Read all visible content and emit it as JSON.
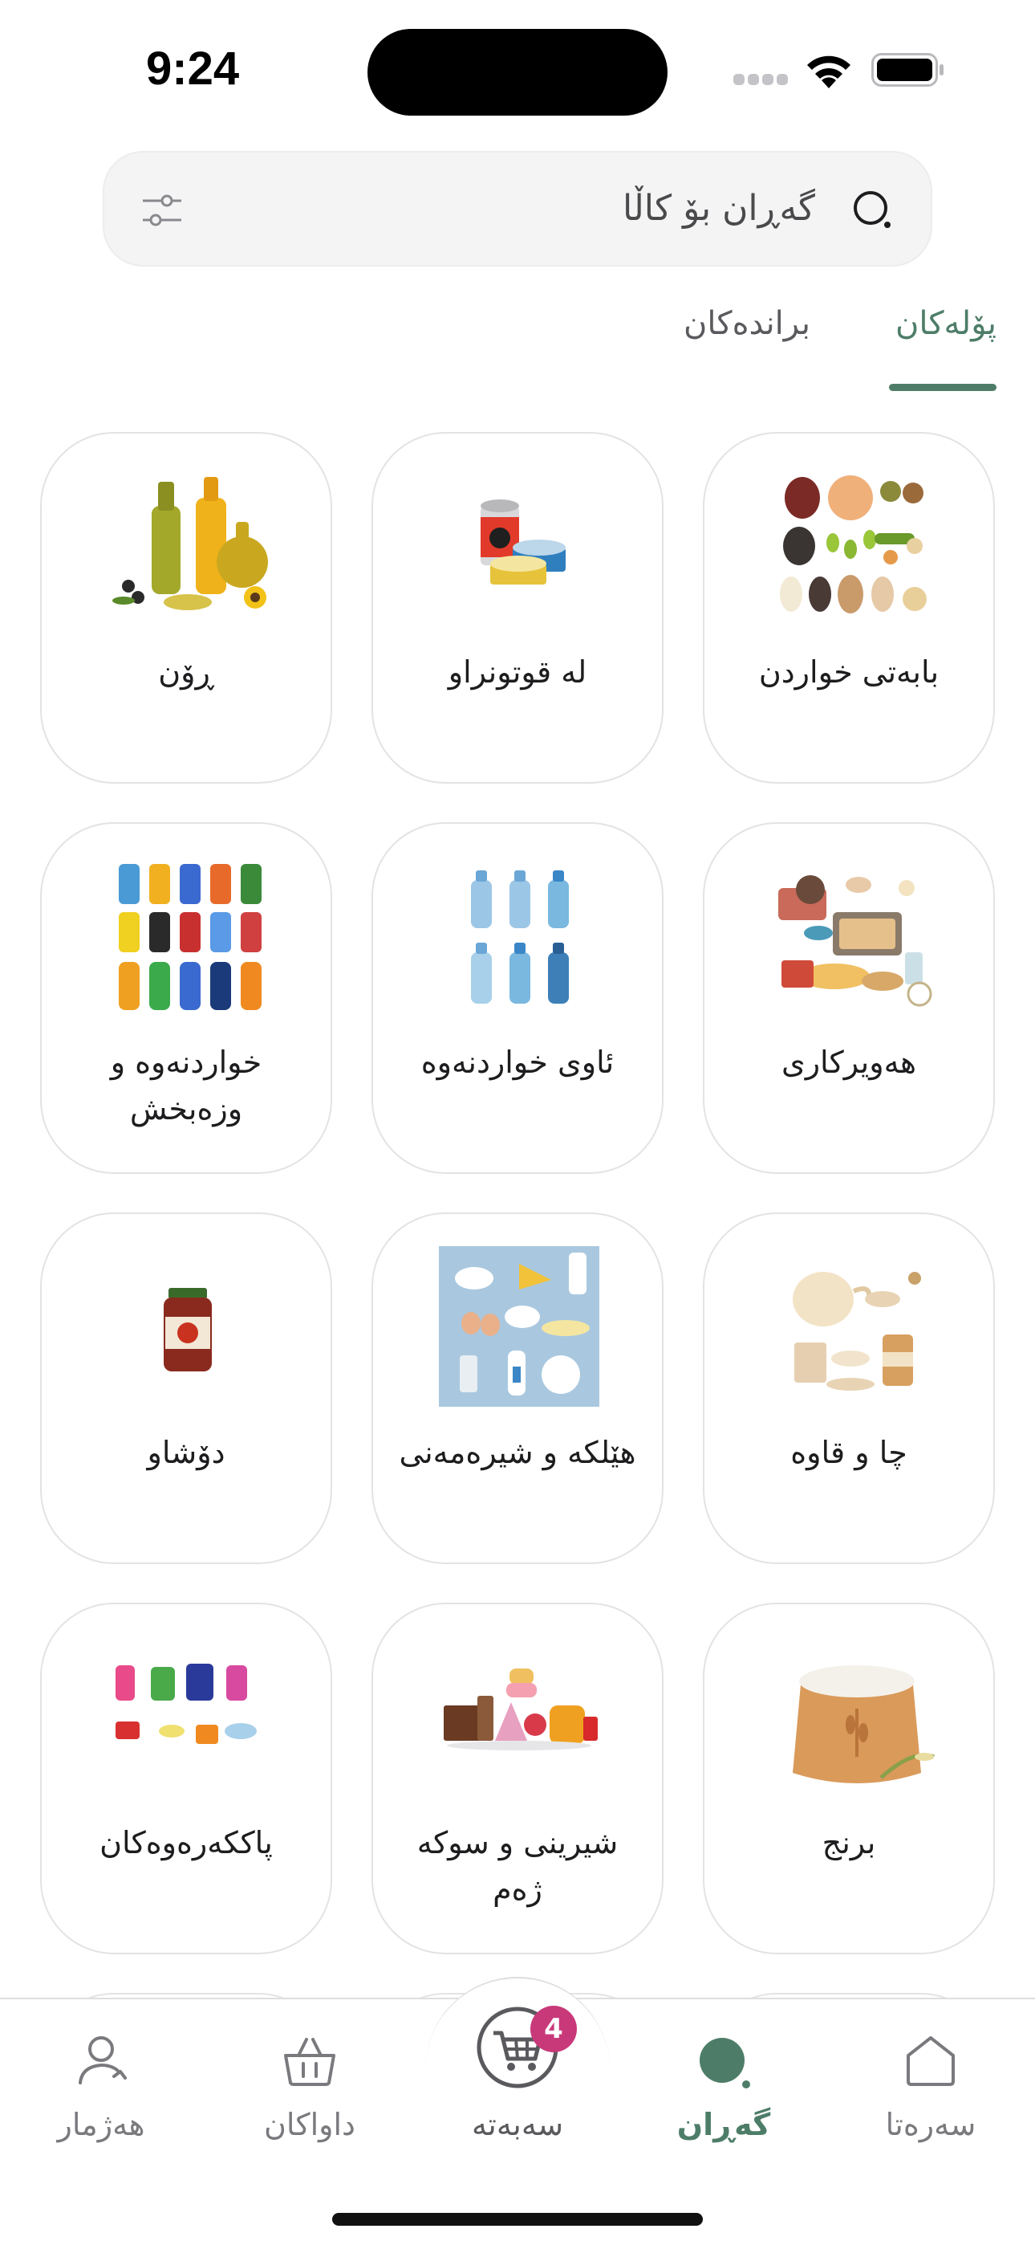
{
  "status_bar": {
    "time": "9:24"
  },
  "search": {
    "placeholder": "گەڕان بۆ کاڵا"
  },
  "tabs": [
    {
      "label": "پۆلەکان",
      "active": true
    },
    {
      "label": "براندەکان",
      "active": false
    }
  ],
  "categories": [
    {
      "label": "بابەتی خواردن",
      "icon": "legumes-image"
    },
    {
      "label": "لە قوتونراو",
      "icon": "canned-food-image"
    },
    {
      "label": "ڕۆن",
      "icon": "cooking-oil-image"
    },
    {
      "label": "هەویرکاری",
      "icon": "baking-image"
    },
    {
      "label": "ئاوی خواردنەوە",
      "icon": "water-bottles-image"
    },
    {
      "label": "خواردنەوە و وزەبخش",
      "icon": "soft-drinks-image"
    },
    {
      "label": "چا و قاوە",
      "icon": "tea-coffee-image"
    },
    {
      "label": "هێلکە و شیرەمەنی",
      "icon": "eggs-dairy-image"
    },
    {
      "label": "دۆشاو",
      "icon": "jam-jar-image"
    },
    {
      "label": "برنج",
      "icon": "rice-sack-image"
    },
    {
      "label": "شیرینی و سوکە ژەم",
      "icon": "sweets-snacks-image"
    },
    {
      "label": "پاککەرەوەکان",
      "icon": "cleaning-products-image"
    }
  ],
  "bottom_nav": {
    "home": "سەرەتا",
    "search": "گەڕان",
    "cart": "سەبەتە",
    "orders": "داواکان",
    "account": "هەژمار",
    "cart_count": "4",
    "active": "search"
  },
  "colors": {
    "accent": "#4d7d68",
    "badge": "#c8397a",
    "search_bg": "#f4f4f5",
    "card_border": "#e3e3e6"
  }
}
